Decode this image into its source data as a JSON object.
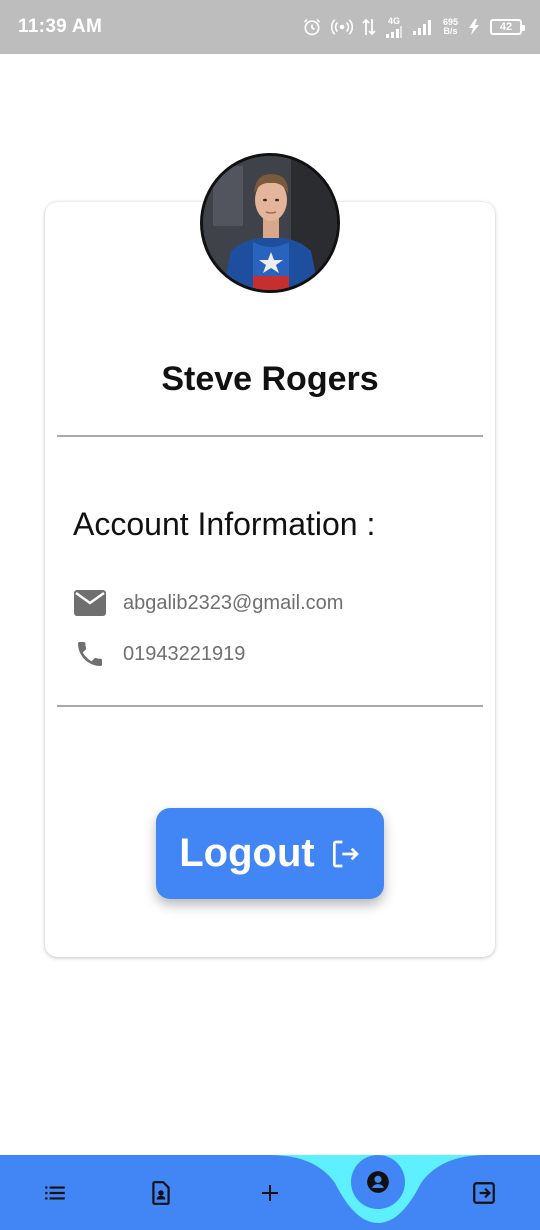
{
  "status_bar": {
    "time": "11:39 AM",
    "network": "4G",
    "speed_value": "695",
    "speed_unit": "B/s",
    "battery": "42"
  },
  "profile": {
    "name": "Steve Rogers",
    "avatar_icon": "user-avatar-photo"
  },
  "account": {
    "title": "Account Information :",
    "email": "abgalib2323@gmail.com",
    "email_icon": "email-icon",
    "phone": "01943221919",
    "phone_icon": "phone-icon"
  },
  "logout": {
    "label": "Logout",
    "icon": "logout-arrow-icon"
  },
  "bottom_nav": {
    "items": [
      {
        "icon": "list-icon"
      },
      {
        "icon": "document-user-icon"
      },
      {
        "icon": "plus-icon"
      },
      {
        "icon": "account-icon",
        "active": true
      },
      {
        "icon": "exit-icon"
      }
    ]
  },
  "colors": {
    "accent": "#4285f4",
    "nav_highlight": "#5ef0ff",
    "status_bar": "#bdbdbd"
  }
}
